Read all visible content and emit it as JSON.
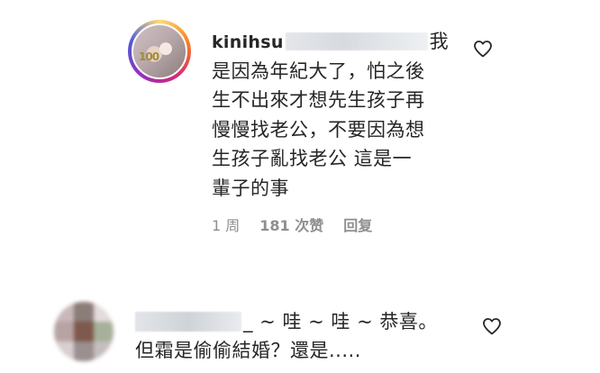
{
  "comment1": {
    "username": "kinihsu",
    "lines": [
      "我",
      "是因為年紀大了，怕之後",
      "生不出來才想先生孩子再",
      "慢慢找老公，不要因為想",
      "生孩子亂找老公 這是一",
      "輩子的事"
    ],
    "time": "1 周",
    "likes": "181 次赞",
    "reply": "回复"
  },
  "comment2": {
    "lines_line1_tail": "_ ~ 哇 ~ 哇 ~ 恭喜。",
    "line2": "但霜是偷偷結婚？還是....."
  },
  "icons": {
    "like": "heart-outline-icon"
  },
  "colors": {
    "text": "#262626",
    "meta": "#8e8e8e",
    "avatar_ring": [
      "#feda75",
      "#fa7e1e",
      "#d62976",
      "#962fbf",
      "#4f5bd5"
    ]
  }
}
